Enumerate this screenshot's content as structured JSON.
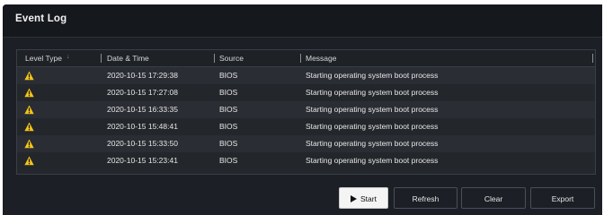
{
  "window": {
    "title": "Event Log"
  },
  "table": {
    "columns": [
      "Level Type",
      "Date & Time",
      "Source",
      "Message"
    ],
    "sort_icon": "sort-arrow",
    "rows": [
      {
        "level": "warning",
        "datetime": "2020-10-15 17:29:38",
        "source": "BIOS",
        "message": "Starting operating system boot process"
      },
      {
        "level": "warning",
        "datetime": "2020-10-15 17:27:08",
        "source": "BIOS",
        "message": "Starting operating system boot process"
      },
      {
        "level": "warning",
        "datetime": "2020-10-15 16:33:35",
        "source": "BIOS",
        "message": "Starting operating system boot process"
      },
      {
        "level": "warning",
        "datetime": "2020-10-15 15:48:41",
        "source": "BIOS",
        "message": "Starting operating system boot process"
      },
      {
        "level": "warning",
        "datetime": "2020-10-15 15:33:50",
        "source": "BIOS",
        "message": "Starting operating system boot process"
      },
      {
        "level": "warning",
        "datetime": "2020-10-15 15:23:41",
        "source": "BIOS",
        "message": "Starting operating system boot process"
      }
    ]
  },
  "buttons": {
    "start": "Start",
    "refresh": "Refresh",
    "clear": "Clear",
    "export": "Export"
  },
  "colors": {
    "background": "#1c1f25",
    "warning": "#f5c518",
    "primary_button": "#f4f4f4"
  }
}
